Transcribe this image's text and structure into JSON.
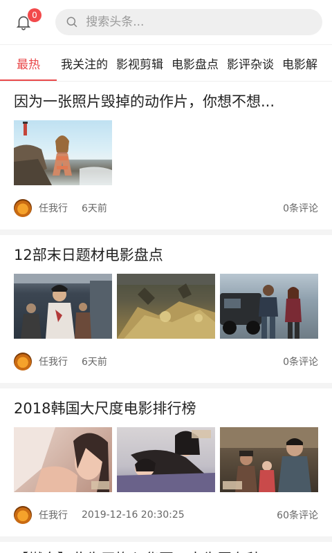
{
  "header": {
    "bell_icon": "bell-icon",
    "notification_count": "0",
    "search_placeholder": "搜索头条..."
  },
  "tabs": [
    {
      "label": "最热",
      "active": true
    },
    {
      "label": "我关注的",
      "active": false
    },
    {
      "label": "影视剪辑",
      "active": false
    },
    {
      "label": "电影盘点",
      "active": false
    },
    {
      "label": "影评杂谈",
      "active": false
    },
    {
      "label": "电影解",
      "active": false
    }
  ],
  "articles": [
    {
      "title": "因为一张照片毁掉的动作片，你想不想...",
      "images": [
        "beach-photo"
      ],
      "author": "任我行",
      "time": "6天前",
      "comments": "0条评论"
    },
    {
      "title": "12部末日题材电影盘点",
      "images": [
        "train-zombie-scene",
        "flood-debris-scene",
        "street-action-scene"
      ],
      "author": "任我行",
      "time": "6天前",
      "comments": "0条评论"
    },
    {
      "title": "2018韩国大尺度电影排行榜",
      "images": [
        "film-still-1",
        "film-still-2",
        "film-still-3"
      ],
      "author": "任我行",
      "time": "2019-12-16 20:30:25",
      "comments": "60条评论"
    }
  ],
  "last_article_title": "【燃向】此生无悔入华夏，来生愿在种..."
}
